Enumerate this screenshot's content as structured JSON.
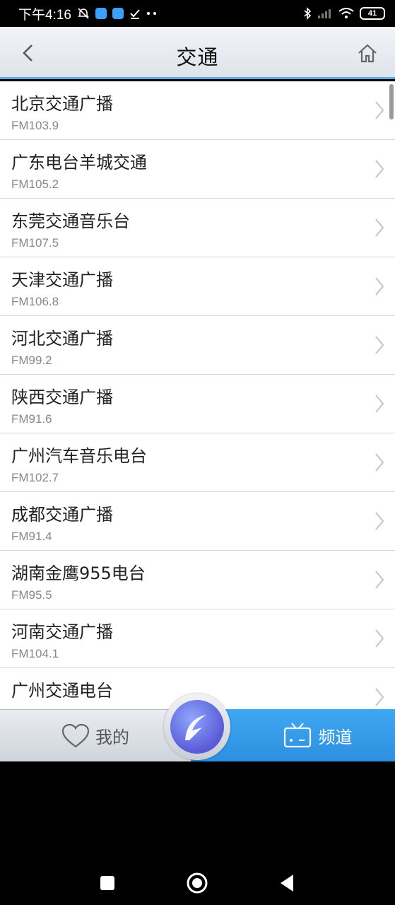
{
  "status": {
    "time": "下午4:16",
    "battery": "41"
  },
  "header": {
    "title": "交通"
  },
  "stations": [
    {
      "name": "北京交通广播",
      "freq": "FM103.9"
    },
    {
      "name": "广东电台羊城交通",
      "freq": "FM105.2"
    },
    {
      "name": "东莞交通音乐台",
      "freq": "FM107.5"
    },
    {
      "name": "天津交通广播",
      "freq": "FM106.8"
    },
    {
      "name": "河北交通广播",
      "freq": "FM99.2"
    },
    {
      "name": "陕西交通广播",
      "freq": "FM91.6"
    },
    {
      "name": "广州汽车音乐电台",
      "freq": "FM102.7"
    },
    {
      "name": "成都交通广播",
      "freq": "FM91.4"
    },
    {
      "name": "湖南金鹰955电台",
      "freq": "FM95.5"
    },
    {
      "name": "河南交通广播",
      "freq": "FM104.1"
    },
    {
      "name": "广州交通电台",
      "freq": ""
    }
  ],
  "tabs": {
    "mine": "我的",
    "channel": "频道"
  },
  "colors": {
    "accent": "#3fa8f2",
    "header_line": "#5aa9e6"
  }
}
